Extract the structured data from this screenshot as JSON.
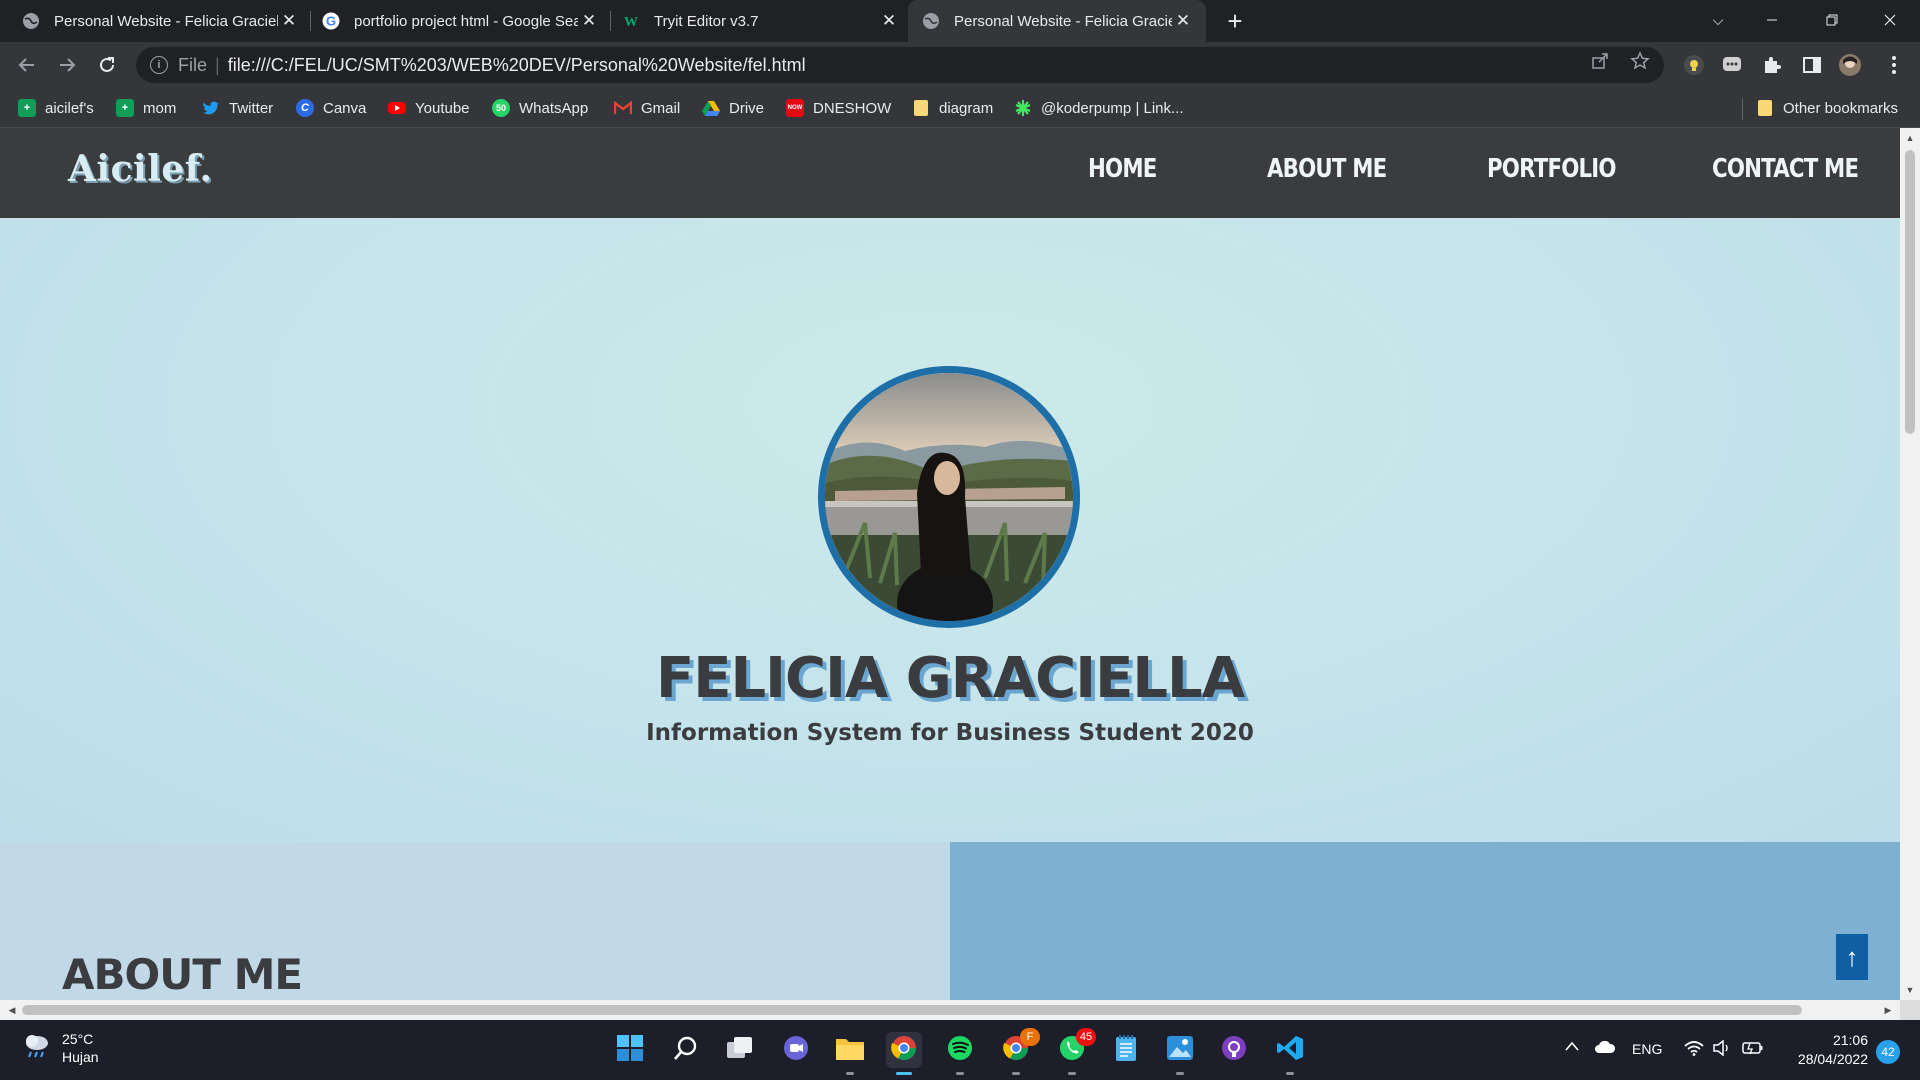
{
  "browser": {
    "tabs": [
      {
        "title": "Personal Website - Felicia Graciella",
        "active": false
      },
      {
        "title": "portfolio project html - Google Search",
        "active": false
      },
      {
        "title": "Tryit Editor v3.7",
        "active": false
      },
      {
        "title": "Personal Website - Felicia Graciella",
        "active": true
      }
    ],
    "new_tab": "+",
    "omnibox": {
      "protocol_label": "File",
      "url": "file:///C:/FEL/UC/SMT%203/WEB%20DEV/Personal%20Website/fel.html"
    },
    "bookmarks": [
      {
        "label": "aicilef's",
        "icon": "sheets-icon",
        "color": "#0f9d58"
      },
      {
        "label": "mom",
        "icon": "sheets-icon",
        "color": "#0f9d58"
      },
      {
        "label": "Twitter",
        "icon": "twitter-icon",
        "color": "#1d9bf0"
      },
      {
        "label": "Canva",
        "icon": "canva-icon",
        "color": "#2b6ce6"
      },
      {
        "label": "Youtube",
        "icon": "youtube-icon",
        "color": "#ff0000"
      },
      {
        "label": "WhatsApp",
        "icon": "whatsapp-icon",
        "color": "#25d366"
      },
      {
        "label": "Gmail",
        "icon": "gmail-icon",
        "color": "#ea4335"
      },
      {
        "label": "Drive",
        "icon": "drive-icon",
        "color": "#fbbc04"
      },
      {
        "label": "DNESHOW",
        "icon": "dneshow-icon",
        "color": "#e50914"
      },
      {
        "label": "diagram",
        "icon": "folder-icon",
        "color": "#f8d775"
      },
      {
        "label": "@koderpump | Link...",
        "icon": "linktree-icon",
        "color": "#43e660"
      }
    ],
    "other_bookmarks": "Other bookmarks"
  },
  "site": {
    "logo": "Aicilef.",
    "nav": [
      "HOME",
      "ABOUT ME",
      "PORTFOLIO",
      "CONTACT ME"
    ],
    "hero": {
      "name": "FELICIA GRACIELLA",
      "subtitle": "Information System for Business Student 2020"
    },
    "about_title": "ABOUT ME",
    "scroll_top_icon": "↑",
    "colors": {
      "nav_bg": "#3b3c3e",
      "hero_bg": "#c6e3ea",
      "about_left": "#c1d9e7",
      "about_right": "#7eb1d1",
      "accent": "#1e6fa8"
    }
  },
  "taskbar": {
    "weather": {
      "temp": "25°C",
      "condition": "Hujan"
    },
    "tray_lang": "ENG",
    "clock": {
      "time": "21:06",
      "date": "28/04/2022"
    },
    "notifications": "42",
    "whatsapp_badge": "45",
    "chrome_badge": "F"
  }
}
